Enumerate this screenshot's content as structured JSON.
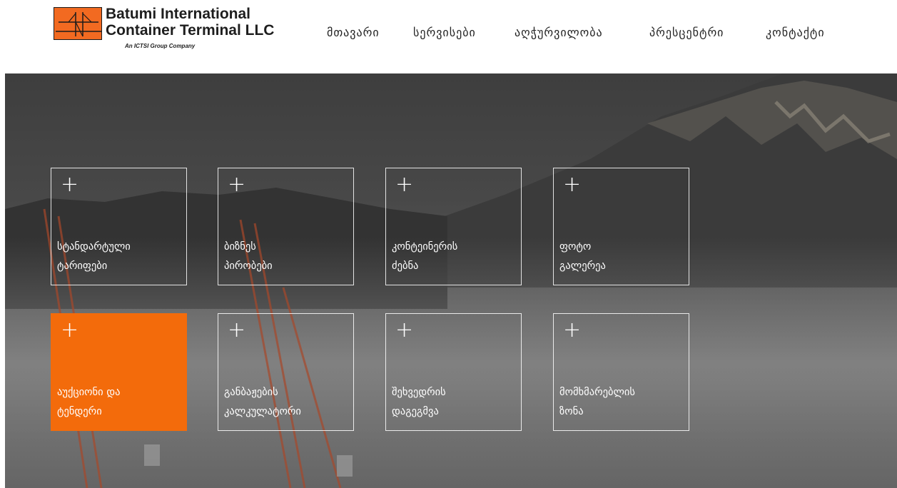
{
  "logo": {
    "line1": "Batumi International",
    "line2": "Container Terminal LLC",
    "tagline": "An ICTSI Group Company",
    "brand_color": "#f26a21"
  },
  "nav": {
    "items": [
      "მთავარი",
      "სერვისები",
      "აღჭურვილობა",
      "პრესცენტრი",
      "კონტაქტი"
    ]
  },
  "tiles": [
    {
      "line1": "სტანდარტული",
      "line2": "ტარიფები",
      "icon": "plus-icon",
      "active": false
    },
    {
      "line1": "ბიზნეს",
      "line2": "პირობები",
      "icon": "plus-icon",
      "active": false
    },
    {
      "line1": "კონტეინერის",
      "line2": "ძებნა",
      "icon": "plus-icon",
      "active": false
    },
    {
      "line1": "ფოტო",
      "line2": "გალერეა",
      "icon": "plus-icon",
      "active": false
    },
    {
      "line1": "აუქციონი და",
      "line2": "ტენდერი",
      "icon": "plus-icon",
      "active": true
    },
    {
      "line1": "განბაჟების",
      "line2": "კალკულატორი",
      "icon": "plus-icon",
      "active": false
    },
    {
      "line1": "შეხვედრის",
      "line2": "დაგეგმვა",
      "icon": "plus-icon",
      "active": false
    },
    {
      "line1": "მომხმარებლის",
      "line2": "ზონა",
      "icon": "plus-icon",
      "active": false
    }
  ],
  "colors": {
    "accent": "#f36b0b",
    "tile_border": "#ffffff"
  }
}
